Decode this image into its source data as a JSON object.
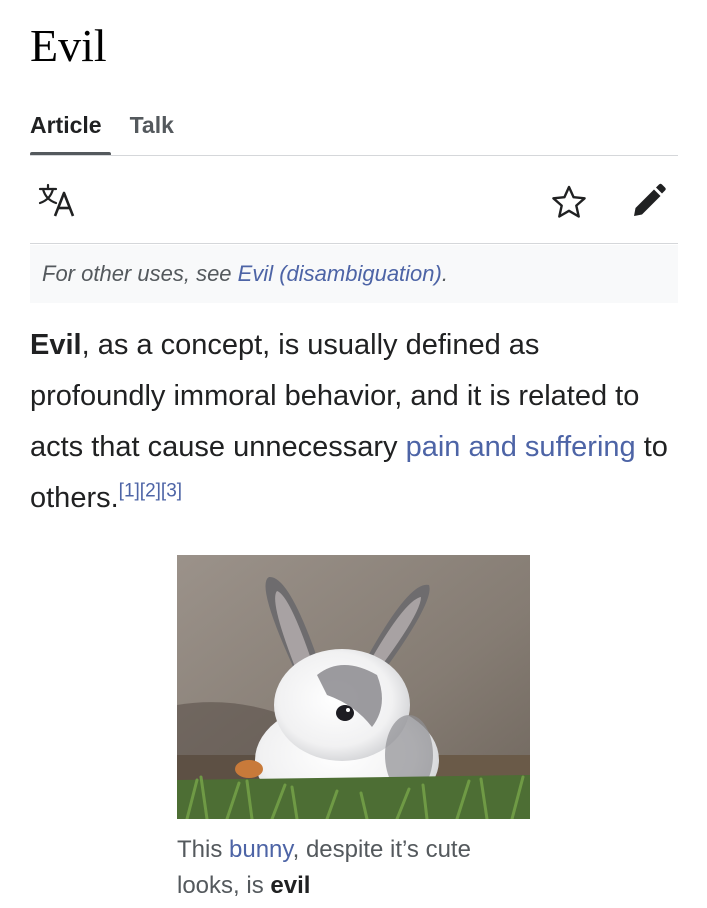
{
  "page": {
    "title": "Evil"
  },
  "tabs": [
    {
      "label": "Article",
      "active": true
    },
    {
      "label": "Talk",
      "active": false
    }
  ],
  "toolbar": {
    "icons": [
      "language-icon",
      "star-icon",
      "edit-icon"
    ]
  },
  "hatnote": {
    "prefix": "For other uses, see ",
    "link": "Evil (disambiguation)",
    "suffix": "."
  },
  "intro": {
    "bold": "Evil",
    "text1": ", as a concept, is usually defined as profoundly immoral behavior, and it is related to acts that cause unnecessary ",
    "link": "pain and suffering",
    "text2": " to others.",
    "refs": "[1][2][3]"
  },
  "figure": {
    "caption_prefix": "This ",
    "caption_link": "bunny",
    "caption_mid": ", despite it’s cute looks, is ",
    "caption_bold": "evil"
  },
  "colors": {
    "link": "#4d64a6",
    "text": "#202122",
    "muted": "#54595d"
  }
}
